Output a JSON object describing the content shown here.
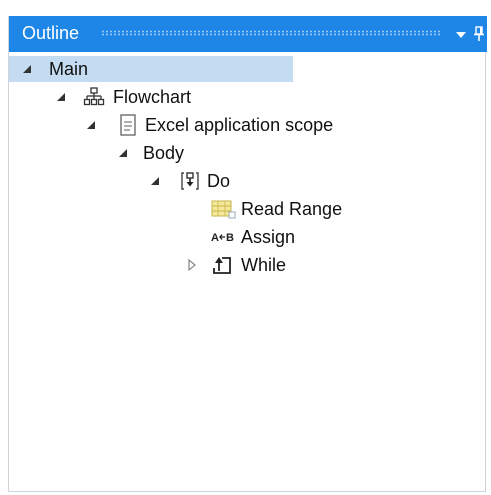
{
  "panel": {
    "title": "Outline",
    "colors": {
      "titlebar": "#1d86e6",
      "selection": "#c4dcf1",
      "text": "#111111"
    }
  },
  "tree": {
    "nodes": [
      {
        "label": "Main",
        "icon": "",
        "expanded": true,
        "selected": true
      },
      {
        "label": "Flowchart",
        "icon": "flowchart-icon",
        "expanded": true,
        "selected": false
      },
      {
        "label": "Excel application scope",
        "icon": "document-icon",
        "expanded": true,
        "selected": false
      },
      {
        "label": "Body",
        "icon": "",
        "expanded": true,
        "selected": false
      },
      {
        "label": "Do",
        "icon": "sequence-icon",
        "expanded": true,
        "selected": false
      },
      {
        "label": "Read Range",
        "icon": "read-range-icon",
        "expanded": false,
        "selected": false
      },
      {
        "label": "Assign",
        "icon": "assign-icon",
        "expanded": false,
        "selected": false
      },
      {
        "label": "While",
        "icon": "while-loop-icon",
        "expanded": false,
        "selected": false
      }
    ]
  }
}
